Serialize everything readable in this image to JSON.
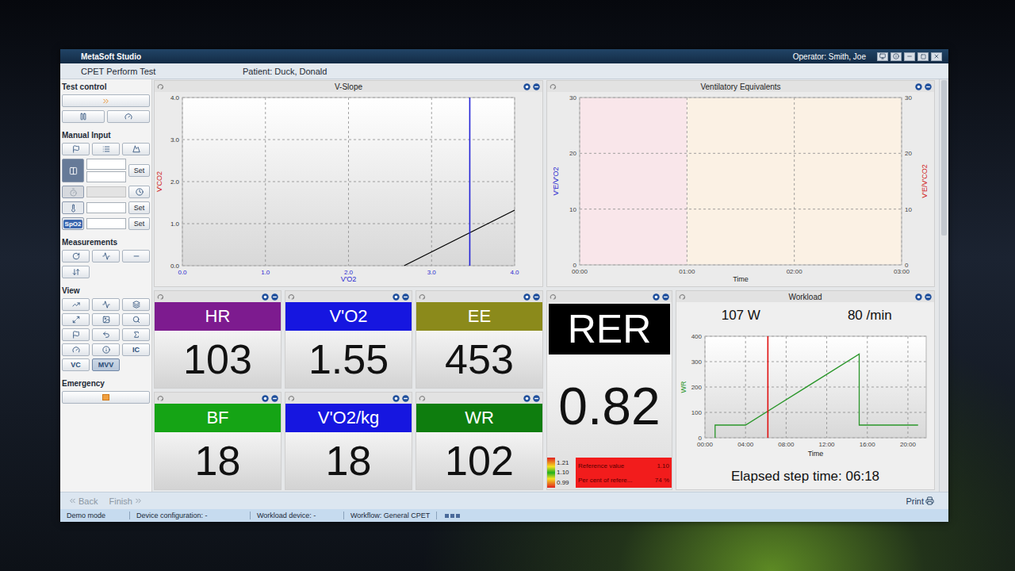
{
  "window": {
    "title": "MetaSoft Studio",
    "operator": "Operator: Smith, Joe"
  },
  "header": {
    "screen": "CPET Perform Test",
    "patient": "Patient: Duck, Donald"
  },
  "sidebar": {
    "test_control": {
      "title": "Test control"
    },
    "manual_input": {
      "title": "Manual Input",
      "rows": [
        {
          "kind": "pair",
          "values": [
            "",
            ""
          ],
          "action": "Set",
          "disabled": false
        },
        {
          "kind": "timer",
          "values": [
            ""
          ],
          "disabled": true
        },
        {
          "kind": "single",
          "values": [
            ""
          ],
          "action": "Set",
          "disabled": false
        },
        {
          "kind": "single",
          "badge": "SpO2",
          "values": [
            ""
          ],
          "action": "Set",
          "disabled": false
        }
      ]
    },
    "measurements": {
      "title": "Measurements"
    },
    "view": {
      "title": "View",
      "text_buttons": [
        {
          "label": "IC",
          "selected": false
        },
        {
          "label": "VC",
          "selected": false
        },
        {
          "label": "MVV",
          "selected": true
        }
      ]
    },
    "emergency": {
      "title": "Emergency"
    }
  },
  "v_slope": {
    "title": "V-Slope",
    "x_label": "V'O2",
    "y_label": "V'CO2",
    "x_ticks": [
      "0.0",
      "1.0",
      "2.0",
      "3.0",
      "4.0"
    ],
    "y_ticks": [
      "0.0",
      "1.0",
      "2.0",
      "3.0",
      "4.0"
    ],
    "x_range": [
      0,
      4
    ],
    "y_range": [
      0,
      4
    ],
    "series": [
      {
        "color": "#000000",
        "x": [
          2.67,
          4.0
        ],
        "y": [
          0,
          1.32
        ]
      }
    ],
    "markers": [
      {
        "x": 3.46,
        "color": "#2323d6"
      }
    ]
  },
  "ventilatory_equivalents": {
    "title": "Ventilatory Equivalents",
    "x_label": "Time",
    "y_label": "V'E/V'O2",
    "y2_label": "V'E/V'CO2",
    "x_ticks": [
      "00:00",
      "01:00",
      "02:00",
      "03:00"
    ],
    "y_ticks": [
      "0",
      "10",
      "20",
      "30"
    ],
    "y2_ticks": [
      "0",
      "10",
      "20",
      "30"
    ],
    "x_range": [
      0,
      3
    ],
    "y_range": [
      0,
      30
    ],
    "bands": [
      {
        "start": 0,
        "end": 1,
        "color": "#f9e6ea"
      },
      {
        "start": 1,
        "end": 3,
        "color": "#fbf1e4"
      }
    ]
  },
  "tiles": [
    {
      "label": "HR",
      "value": "103",
      "color": "#7d1b8f"
    },
    {
      "label": "V'O2",
      "value": "1.55",
      "color": "#1616e0"
    },
    {
      "label": "EE",
      "value": "453",
      "color": "#8b8a1b"
    },
    {
      "label": "BF",
      "value": "18",
      "color": "#15a415"
    },
    {
      "label": "V'O2/kg",
      "value": "18",
      "color": "#1616e0"
    },
    {
      "label": "WR",
      "value": "102",
      "color": "#0e7d0e"
    }
  ],
  "rer": {
    "label": "RER",
    "value": "0.82",
    "scale": [
      "1.21",
      "1.10",
      "0.99"
    ],
    "reference": {
      "label": "Reference value",
      "value": "1.10"
    },
    "percent": {
      "label": "Per cent of refere...",
      "value": "74 %"
    }
  },
  "workload": {
    "title": "Workload",
    "power": "107 W",
    "rate": "80 /min",
    "y_label": "WR",
    "x_label": "Time",
    "y_ticks": [
      "0",
      "100",
      "200",
      "300",
      "400"
    ],
    "x_ticks": [
      "00:00",
      "04:00",
      "08:00",
      "12:00",
      "16:00",
      "20:00"
    ],
    "x_range": [
      0,
      21.8
    ],
    "y_range": [
      0,
      400
    ],
    "series": [
      {
        "color": "#2a962a",
        "x": [
          1,
          1,
          4,
          15.2,
          15.2,
          21
        ],
        "y": [
          0,
          50,
          50,
          330,
          50,
          50
        ]
      }
    ],
    "markers": [
      {
        "x": 6.2,
        "color": "#e01010"
      }
    ],
    "elapsed": "Elapsed step time: 06:18"
  },
  "footer": {
    "back": {
      "label": "Back",
      "disabled": true
    },
    "finish": {
      "label": "Finish",
      "disabled": true
    },
    "print": {
      "label": "Print"
    }
  },
  "status_bar": [
    "Demo mode",
    "Device configuration: -",
    "Workload device: -",
    "Workflow: General CPET"
  ]
}
